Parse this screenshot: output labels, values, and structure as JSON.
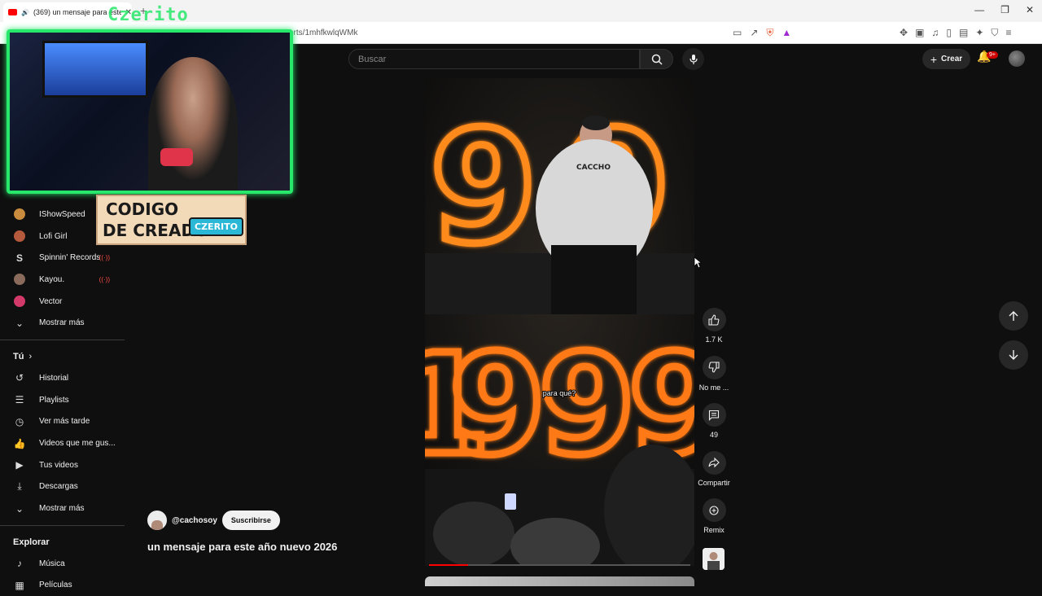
{
  "browser": {
    "tab_title": "(369) un mensaje para este",
    "tab_close": "✕",
    "new_tab": "+",
    "url": "orts/1mhfkwlqWMk"
  },
  "overlay": {
    "streamer_name": "Czerito",
    "code_line1": "CODIGO",
    "code_line2": "DE CREADOR",
    "code_badge": "CZERITO"
  },
  "sidebar": {
    "subscriptions": [
      {
        "label": "IShowSpeed",
        "color": "#c98b3e",
        "live": false
      },
      {
        "label": "Lofi Girl",
        "color": "#b55a3c",
        "live": false
      },
      {
        "label": "Spinnin' Records",
        "color": "#ffffff",
        "live": true
      },
      {
        "label": "Kayou.",
        "color": "#8a6a5a",
        "live": true
      },
      {
        "label": "Vector",
        "color": "#d23a6a",
        "live": false
      }
    ],
    "live_indicator": "((·))",
    "show_more": "Mostrar más",
    "you_heading": "Tú",
    "you_items": [
      {
        "label": "Historial",
        "icon": "history-icon"
      },
      {
        "label": "Playlists",
        "icon": "playlist-icon"
      },
      {
        "label": "Ver más tarde",
        "icon": "clock-icon"
      },
      {
        "label": "Videos que me gus...",
        "icon": "thumb-up-icon"
      },
      {
        "label": "Tus videos",
        "icon": "video-icon"
      },
      {
        "label": "Descargas",
        "icon": "download-icon"
      }
    ],
    "show_more_2": "Mostrar más",
    "explore_heading": "Explorar",
    "explore_items": [
      {
        "label": "Música",
        "icon": "music-icon"
      },
      {
        "label": "Películas",
        "icon": "film-icon"
      }
    ]
  },
  "header": {
    "search_placeholder": "Buscar",
    "create_label": "Crear",
    "notifications_badge": "9+"
  },
  "short": {
    "caption": "para qué?",
    "shirt_text": "CACCHO",
    "channel": "@cachosoy",
    "subscribe": "Suscribirse",
    "title": "un mensaje para este año nuevo 2026",
    "progress": 0.15
  },
  "actions": {
    "like_count": "1.7 K",
    "dislike_label": "No me ...",
    "comments_count": "49",
    "share_label": "Compartir",
    "remix_label": "Remix"
  }
}
